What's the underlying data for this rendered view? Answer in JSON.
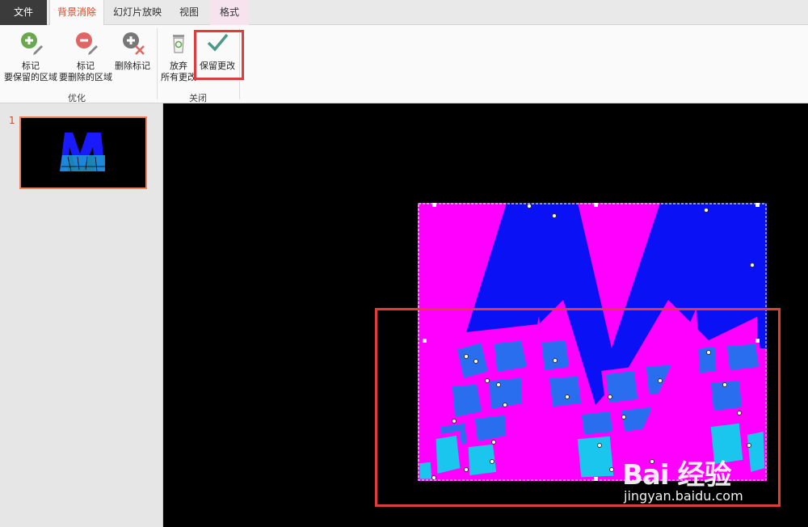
{
  "tabs": {
    "file": "文件",
    "background_removal": "背景消除",
    "slideshow": "幻灯片放映",
    "view": "视图",
    "format": "格式"
  },
  "ribbon": {
    "mark_keep_line1": "标记",
    "mark_keep_line2": "要保留的区域",
    "mark_remove_line1": "标记",
    "mark_remove_line2": "要删除的区域",
    "delete_mark": "删除标记",
    "discard_line1": "放弃",
    "discard_line2": "所有更改",
    "keep_changes": "保留更改",
    "group_refine": "优化",
    "group_close": "关闭"
  },
  "slides": {
    "number": "1"
  },
  "watermark": {
    "logo_text": "Bai 经验",
    "url": "jingyan.baidu.com"
  },
  "colors": {
    "accent": "#d24726",
    "highlight_box": "#e03c3c",
    "image_magenta": "#ff00ff",
    "image_blue": "#0a1aff"
  }
}
